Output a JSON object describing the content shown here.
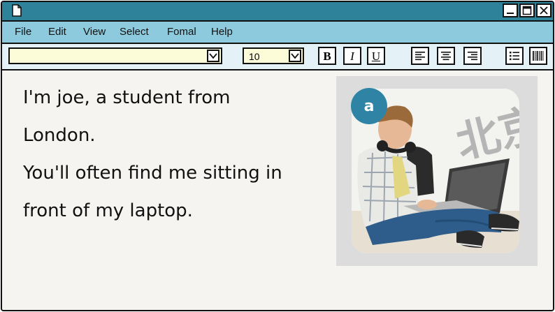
{
  "menu": {
    "file": "File",
    "edit": "Edit",
    "view": "View",
    "select": "Select",
    "format": "Fomal",
    "help": "Help"
  },
  "toolbar": {
    "font_value": "",
    "size_value": "10",
    "bold_label": "B",
    "italic_label": "I",
    "underline_label": "U",
    "icons": [
      "align-left-icon",
      "align-center-icon",
      "align-right-icon",
      "bullet-list-icon",
      "barcode-icon"
    ]
  },
  "document": {
    "lines": [
      "I'm joe, a student from",
      "London.",
      "You'll often find me sitting in",
      "front of my laptop."
    ]
  },
  "photo": {
    "badge_label": "a",
    "background_chars": "北京"
  },
  "colors": {
    "titlebar": "#2e8299",
    "menubar": "#8ecadd",
    "toolbar": "#e4f1f6",
    "select_bg": "#fdfcd9",
    "badge": "#2f84a6",
    "content_bg": "#f5f4f1"
  }
}
